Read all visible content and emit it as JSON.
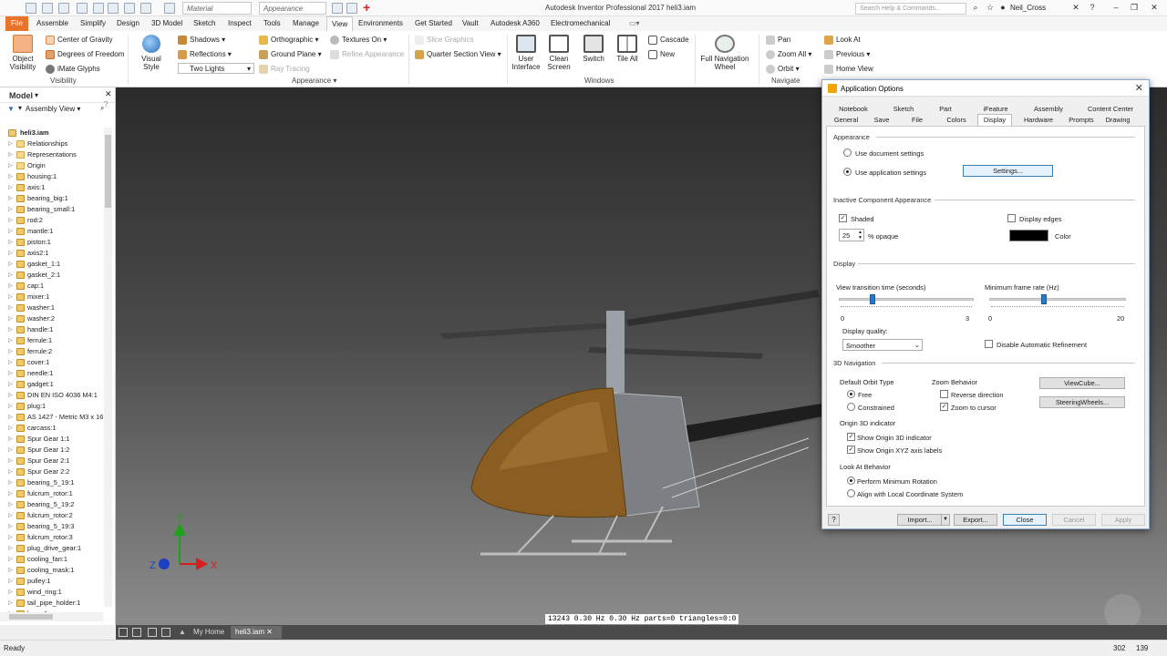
{
  "qat": {
    "material": "Material",
    "appearance": "Appearance",
    "title": "Autodesk Inventor Professional 2017    heli3.iam",
    "search_placeholder": "Search Help & Commands...",
    "user": "Neil_Cross"
  },
  "ribbon_tabs": [
    "File",
    "Assemble",
    "Simplify",
    "Design",
    "3D Model",
    "Sketch",
    "Inspect",
    "Tools",
    "Manage",
    "View",
    "Environments",
    "Get Started",
    "Vault",
    "Autodesk A360",
    "Electromechanical"
  ],
  "ribbon": {
    "object_visibility": "Object\nVisibility",
    "center_of_gravity": "Center of Gravity",
    "degrees_of_freedom": "Degrees of Freedom",
    "imate_glyphs": "iMate Glyphs",
    "visibility_group": "Visibility",
    "visual_style": "Visual Style",
    "shadows": "Shadows",
    "reflections": "Reflections",
    "lighting": "Two Lights",
    "orthographic": "Orthographic",
    "ground_plane": "Ground Plane",
    "textures_on": "Textures On",
    "refine_appearance": "Refine Appearance",
    "ray_tracing": "Ray Tracing",
    "slice_graphics": "Slice Graphics",
    "quarter_section": "Quarter Section View",
    "appearance_group": "Appearance",
    "user_interface": "User\nInterface",
    "clean_screen": "Clean\nScreen",
    "switch": "Switch",
    "tile_all": "Tile All",
    "cascade": "Cascade",
    "new": "New",
    "windows_group": "Windows",
    "full_nav_wheel": "Full Navigation\nWheel",
    "pan": "Pan",
    "zoom_all": "Zoom All",
    "orbit": "Orbit",
    "look_at": "Look At",
    "previous": "Previous",
    "home_view": "Home View",
    "navigate_group": "Navigate"
  },
  "browser": {
    "title": "Model",
    "view": "Assembly View",
    "root": "heli3.iam",
    "items": [
      "Relationships",
      "Representations",
      "Origin",
      "housing:1",
      "axis:1",
      "bearing_big:1",
      "bearing_small:1",
      "rod:2",
      "mantle:1",
      "piston:1",
      "axis2:1",
      "gasket_1:1",
      "gasket_2:1",
      "cap:1",
      "mixer:1",
      "washer:1",
      "washer:2",
      "handle:1",
      "ferrule:1",
      "ferrule:2",
      "cover:1",
      "needle:1",
      "gadget:1",
      "DIN EN ISO 4036 M4:1",
      "plug:1",
      "AS 1427 - Metric M3 x 16:",
      "carcass:1",
      "Spur Gear 1:1",
      "Spur Gear 1:2",
      "Spur Gear 2:1",
      "Spur Gear 2:2",
      "bearing_5_19:1",
      "fulcrum_rotor:1",
      "bearing_5_19:2",
      "fulcrum_rotor:2",
      "bearing_5_19:3",
      "fulcrum_rotor:3",
      "plug_drive_gear:1",
      "cooling_fan:1",
      "cooling_mask:1",
      "pulley:1",
      "wind_ring:1",
      "tail_pipe_holder:1",
      "base:1"
    ]
  },
  "viewport": {
    "stats": "13243  0.30 Hz  0.30 Hz  parts=0 triangles=0:0",
    "axes": {
      "x": "X",
      "y": "Y",
      "z": "Z"
    }
  },
  "doctabs": {
    "home": "My Home",
    "doc": "heli3.iam"
  },
  "status": {
    "text": "Ready",
    "n1": "302",
    "n2": "139"
  },
  "dialog": {
    "title": "Application Options",
    "tabs_row1": [
      "Notebook",
      "Sketch",
      "Part",
      "iFeature",
      "Assembly",
      "Content Center"
    ],
    "tabs_row2": [
      "General",
      "Save",
      "File",
      "Colors",
      "Display",
      "Hardware",
      "Prompts",
      "Drawing"
    ],
    "appearance_section": "Appearance",
    "use_document": "Use document settings",
    "use_application": "Use application settings",
    "settings_btn": "Settings...",
    "inactive_section": "Inactive Component Appearance",
    "shaded": "Shaded",
    "display_edges": "Display edges",
    "opaque_value": "25",
    "opaque_label": "% opaque",
    "color_label": "Color",
    "color_value": "#000000",
    "display_section": "Display",
    "view_transition": "View transition time (seconds)",
    "view_transition_min": "0",
    "view_transition_max": "3",
    "view_transition_value": 0.25,
    "min_frame_rate": "Minimum frame rate (Hz)",
    "min_frame_min": "0",
    "min_frame_max": "20",
    "min_frame_value": 0.4,
    "display_quality_label": "Display quality:",
    "display_quality": "Smoother",
    "disable_refinement": "Disable Automatic Refinement",
    "nav3d_section": "3D Navigation",
    "default_orbit": "Default Orbit Type",
    "free": "Free",
    "constrained": "Constrained",
    "zoom_behavior": "Zoom Behavior",
    "reverse_direction": "Reverse direction",
    "zoom_to_cursor": "Zoom to cursor",
    "viewcube_btn": "ViewCube...",
    "steeringwheels_btn": "SteeringWheels...",
    "origin3d": "Origin 3D indicator",
    "show_origin": "Show Origin 3D indicator",
    "show_xyz": "Show Origin XYZ axis labels",
    "look_at_behavior": "Look At Behavior",
    "min_rotation": "Perform Minimum Rotation",
    "align_local": "Align with Local Coordinate System",
    "import_btn": "Import...",
    "export_btn": "Export...",
    "close_btn": "Close",
    "cancel_btn": "Cancel",
    "apply_btn": "Apply"
  }
}
